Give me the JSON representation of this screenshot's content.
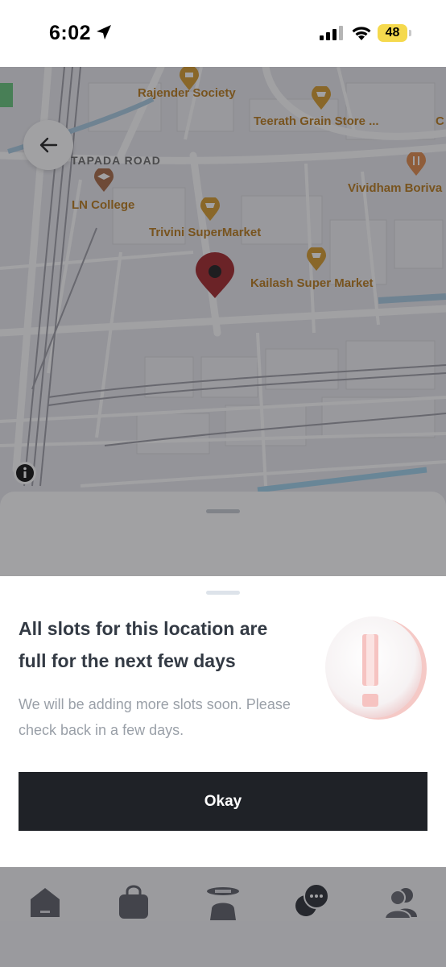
{
  "status_bar": {
    "time": "6:02",
    "battery": "48",
    "icons": [
      "location-arrow-icon",
      "signal-icon",
      "wifi-icon",
      "battery-icon"
    ]
  },
  "map": {
    "labels": {
      "rajender_society": "Rajender Society",
      "teerath_grain_store": "Teerath Grain Store ...",
      "edge_c": "C",
      "road_name": "TAPADA ROAD",
      "vividham": "Vividham Boriva",
      "ln_college": "LN College",
      "trivini": "Trivini SuperMarket",
      "kailash": "Kailash Super Market"
    },
    "colors": {
      "poi_label": "#b87a1c",
      "pin": "#a3262a"
    }
  },
  "dialog": {
    "title": "All slots for this location are full for the next few days",
    "message": "We will be adding more slots soon. Please check back in a few days.",
    "ok_label": "Okay",
    "illustration": "exclamation-warning-icon"
  },
  "bottom_nav": {
    "items": [
      "home-icon",
      "bag-icon",
      "chef-icon",
      "chat-icon",
      "profile-icon"
    ]
  },
  "colors": {
    "primary_button": "#1f2227",
    "title_text": "#333a44",
    "message_text": "#9aa0a8"
  }
}
